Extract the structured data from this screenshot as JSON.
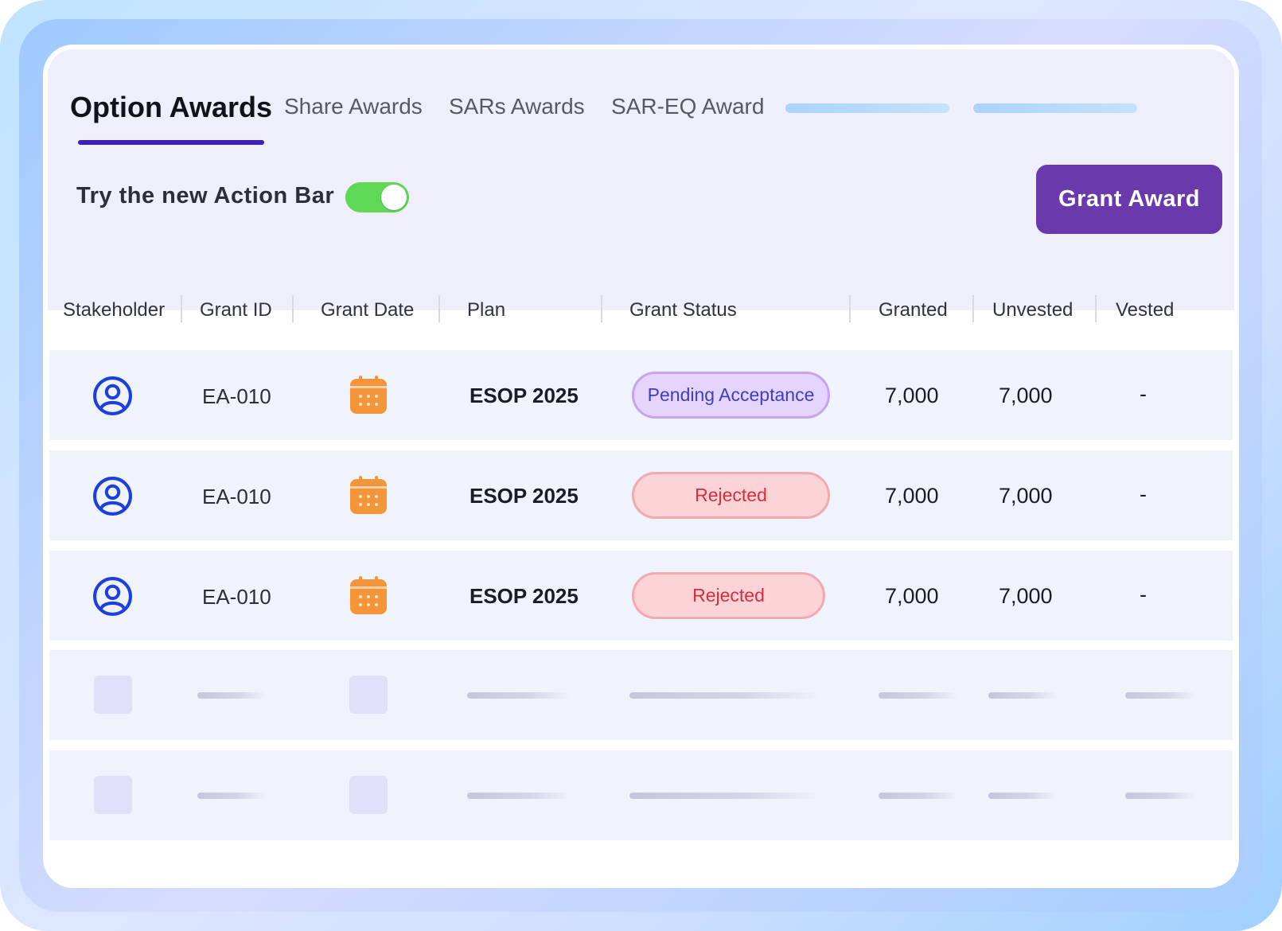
{
  "tabs": [
    {
      "label": "Option Awards",
      "active": true
    },
    {
      "label": "Share Awards",
      "active": false
    },
    {
      "label": "SARs Awards",
      "active": false
    },
    {
      "label": "SAR-EQ Award",
      "active": false
    }
  ],
  "action_bar": {
    "label": "Try the new Action Bar",
    "toggle_on": true
  },
  "grant_button": {
    "label": "Grant Award"
  },
  "table": {
    "columns": [
      "Stakeholder",
      "Grant ID",
      "Grant Date",
      "Plan",
      "Grant Status",
      "Granted",
      "Unvested",
      "Vested"
    ],
    "rows": [
      {
        "stakeholder_icon": "user-circle-icon",
        "grant_id": "EA-010",
        "grant_date_icon": "calendar-icon",
        "plan": "ESOP 2025",
        "status": "Pending Acceptance",
        "granted": "7,000",
        "unvested": "7,000",
        "vested": "-"
      },
      {
        "stakeholder_icon": "user-circle-icon",
        "grant_id": "EA-010",
        "grant_date_icon": "calendar-icon",
        "plan": "ESOP 2025",
        "status": "Rejected",
        "granted": "7,000",
        "unvested": "7,000",
        "vested": "-"
      },
      {
        "stakeholder_icon": "user-circle-icon",
        "grant_id": "EA-010",
        "grant_date_icon": "calendar-icon",
        "plan": "ESOP 2025",
        "status": "Rejected",
        "granted": "7,000",
        "unvested": "7,000",
        "vested": "-"
      }
    ]
  },
  "colors": {
    "accent": "#6a3aad",
    "tab_underline": "#3d1fb4",
    "toggle_on": "#5fd955",
    "user_icon": "#1d3fe0",
    "calendar_icon": "#f4953a",
    "pending_text": "#3c3ecb",
    "rejected_text": "#d72e3d"
  }
}
